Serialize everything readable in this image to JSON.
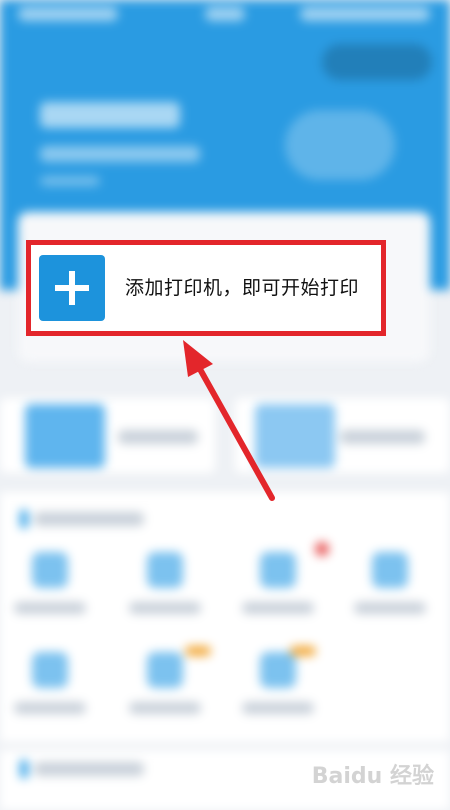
{
  "prompt": {
    "add_label": "添加打印机，即可开始打印"
  },
  "watermark": "Baidu 经验",
  "colors": {
    "header_blue": "#2a9be2",
    "button_blue": "#1d93dc",
    "highlight_red": "#e3262b"
  },
  "icons": {
    "add": "plus-icon",
    "arrow": "red-arrow"
  }
}
